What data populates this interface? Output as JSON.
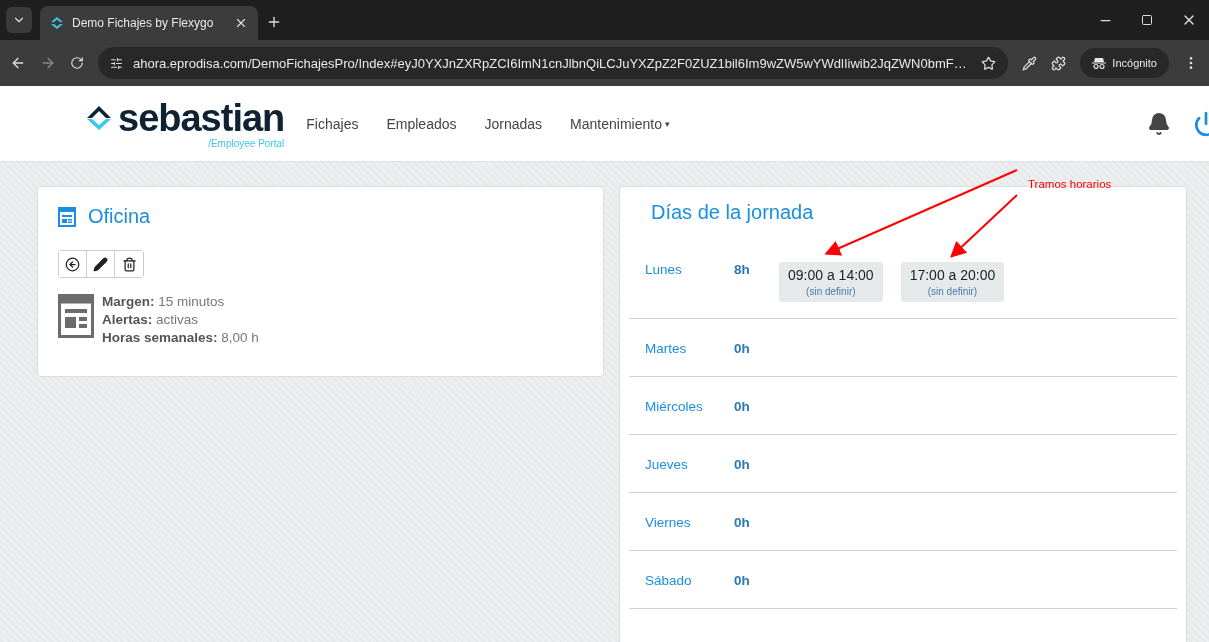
{
  "browser": {
    "tab_title": "Demo Fichajes by Flexygo",
    "url": "ahora.eprodisa.com/DemoFichajesPro/Index#eyJ0YXJnZXRpZCI6ImN1cnJlbnQiLCJuYXZpZ2F0ZUZ1bil6Im9wZW5wYWdlIiwib2JqZWN0bmF…",
    "profile": "Incógnito"
  },
  "header": {
    "logo": "sebastian",
    "logo_subtitle": "/Employee Portal",
    "nav": [
      {
        "label": "Fichajes",
        "kind": "link"
      },
      {
        "label": "Empleados",
        "kind": "link"
      },
      {
        "label": "Jornadas",
        "kind": "link"
      },
      {
        "label": "Mantenimiento",
        "kind": "dropdown",
        "caret": "▾"
      }
    ]
  },
  "office_card": {
    "title": "Oficina",
    "details": [
      "**Margen:** 15 minutos",
      "**Alertas:** activas",
      "**Horas semanales:** 8,00 h"
    ]
  },
  "days_card": {
    "title": "Días de la jornada",
    "days": [
      {
        "name": "Lunes",
        "hours": "8h",
        "slots": [
          {
            "time": "09:00 a 14:00",
            "note": "(sin definir)"
          },
          {
            "time": "17:00 a 20:00",
            "note": "(sin definir)"
          }
        ]
      },
      {
        "name": "Martes",
        "hours": "0h"
      },
      {
        "name": "Miércoles",
        "hours": "0h"
      },
      {
        "name": "Jueves",
        "hours": "0h"
      },
      {
        "name": "Viernes",
        "hours": "0h"
      },
      {
        "name": "Sábado",
        "hours": "0h"
      }
    ]
  },
  "annotation": {
    "label": "Tramos horarios"
  }
}
